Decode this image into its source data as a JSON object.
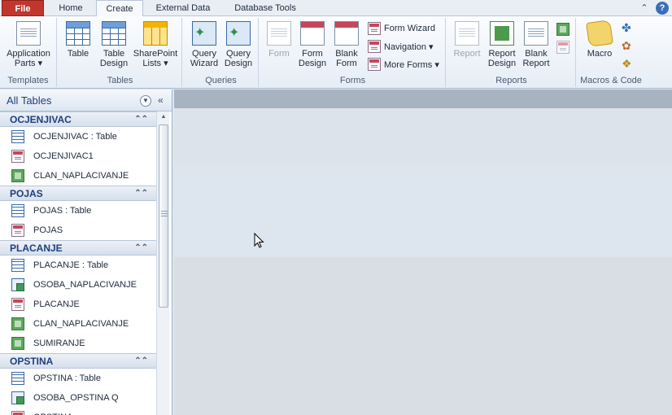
{
  "tabs": {
    "file": "File",
    "home": "Home",
    "create": "Create",
    "external_data": "External Data",
    "database_tools": "Database Tools"
  },
  "ribbon": {
    "templates": {
      "label": "Templates",
      "application_parts": "Application Parts ▾"
    },
    "tables": {
      "label": "Tables",
      "table": "Table",
      "table_design": "Table Design",
      "sharepoint_lists": "SharePoint Lists ▾"
    },
    "queries": {
      "label": "Queries",
      "query_wizard": "Query Wizard",
      "query_design": "Query Design"
    },
    "forms": {
      "label": "Forms",
      "form": "Form",
      "form_design": "Form Design",
      "blank_form": "Blank Form",
      "form_wizard": "Form Wizard",
      "navigation": "Navigation ▾",
      "more_forms": "More Forms ▾"
    },
    "reports": {
      "label": "Reports",
      "report": "Report",
      "report_design": "Report Design",
      "blank_report": "Blank Report"
    },
    "macros": {
      "label": "Macros & Code",
      "macro": "Macro"
    }
  },
  "nav": {
    "title": "All Tables",
    "groups": [
      {
        "name": "OCJENJIVAC",
        "items": [
          {
            "label": "OCJENJIVAC : Table",
            "icon": "table-icon"
          },
          {
            "label": "OCJENJIVAC1",
            "icon": "form-icon"
          },
          {
            "label": "CLAN_NAPLACIVANJE",
            "icon": "report-icon"
          }
        ]
      },
      {
        "name": "POJAS",
        "items": [
          {
            "label": "POJAS : Table",
            "icon": "table-icon"
          },
          {
            "label": "POJAS",
            "icon": "form-icon"
          }
        ]
      },
      {
        "name": "PLACANJE",
        "items": [
          {
            "label": "PLACANJE : Table",
            "icon": "table-icon"
          },
          {
            "label": "OSOBA_NAPLACIVANJE",
            "icon": "query-icon"
          },
          {
            "label": "PLACANJE",
            "icon": "form-icon"
          },
          {
            "label": "CLAN_NAPLACIVANJE",
            "icon": "report-icon"
          },
          {
            "label": "SUMIRANJE",
            "icon": "report-icon"
          }
        ]
      },
      {
        "name": "OPSTINA",
        "items": [
          {
            "label": "OPSTINA : Table",
            "icon": "table-icon"
          },
          {
            "label": "OSOBA_OPSTINA Q",
            "icon": "query-icon"
          },
          {
            "label": "OPSTINA",
            "icon": "form-icon"
          }
        ]
      }
    ]
  }
}
